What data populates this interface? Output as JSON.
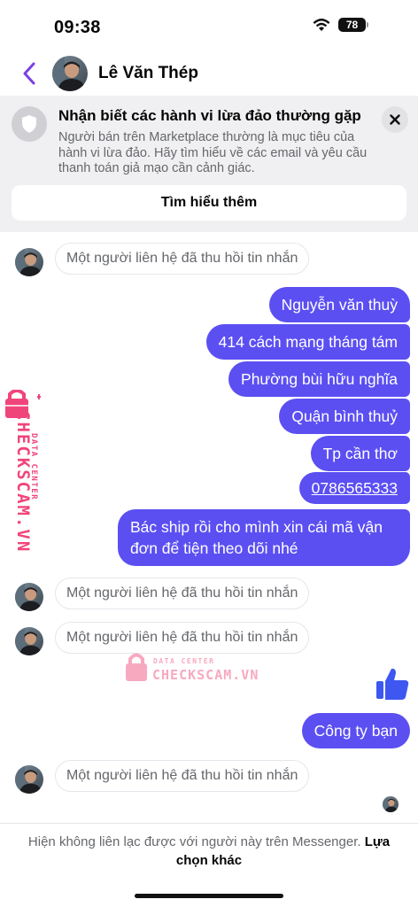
{
  "status_bar": {
    "time": "09:38",
    "battery": "78"
  },
  "header": {
    "contact_name": "Lê Văn Thép"
  },
  "scam_notice": {
    "title": "Nhận biết các hành vi lừa đảo thường gặp",
    "body": "Người bán trên Marketplace thường là mục tiêu của hành vi lừa đảo. Hãy tìm hiểu về các email và yêu cầu thanh toán giả mạo cần cảnh giác.",
    "learn_more_label": "Tìm hiểu thêm"
  },
  "messages": {
    "unsent_text": "Một người liên hệ đã thu hồi tin nhắn",
    "sent": [
      "Nguyễn văn thuỳ",
      "414 cách mạng tháng tám",
      "Phường bùi hữu nghĩa",
      "Quận bình thuỷ",
      "Tp cần thơ",
      "0786565333",
      "Bác ship rồi cho mình xin cái mã vận đơn để tiện theo dõi nhé",
      "Công ty bạn"
    ]
  },
  "footer": {
    "notice": "Hiện không liên lạc được với người này trên Messenger.",
    "action": "Lựa chọn khác"
  },
  "watermark": {
    "brand": "CHECKSCAM.VN",
    "tagline": "DATA CENTER",
    "color": "#f0457a"
  },
  "colors": {
    "accent": "#7b3fe4",
    "bubble": "#5b4ff2",
    "thumb": "#3d57f0"
  }
}
